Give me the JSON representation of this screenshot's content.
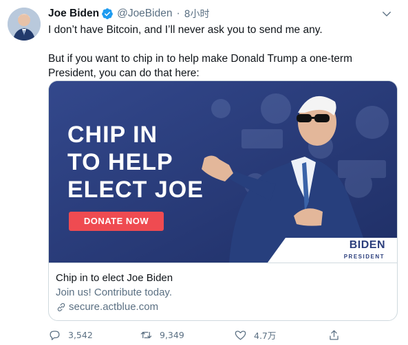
{
  "author": {
    "name": "Joe Biden",
    "handle": "@JoeBiden",
    "separator": "·",
    "time": "8小时"
  },
  "tweet": {
    "paragraphs": [
      "I don’t have Bitcoin, and I’ll never ask you to send me any.",
      "But if you want to chip in to help make Donald Trump a one-term President, you can do that here:"
    ]
  },
  "card": {
    "image": {
      "line1": "CHIP IN",
      "line2": "TO HELP",
      "line3": "ELECT JOE",
      "button_label": "DONATE NOW",
      "logo_text": "BIDEN",
      "logo_sub": "PRESIDENT"
    },
    "title": "Chip in to elect Joe Biden",
    "description": "Join us! Contribute today.",
    "url": "secure.actblue.com"
  },
  "actions": {
    "reply_count": "3,542",
    "retweet_count": "9,349",
    "like_count": "4.7万"
  },
  "colors": {
    "accent": "#1d9bf0",
    "brand_navy": "#2b3e7c",
    "donate_red": "#ef4b51",
    "muted": "#5b7083"
  },
  "icons": [
    "verified-badge-icon",
    "chevron-down-icon",
    "link-icon",
    "reply-icon",
    "retweet-icon",
    "like-icon",
    "share-icon"
  ]
}
